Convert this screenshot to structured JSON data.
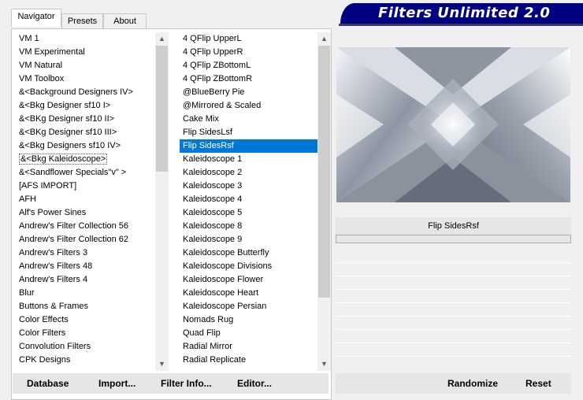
{
  "tabs": [
    "Navigator",
    "Presets",
    "About"
  ],
  "app_title": "Filters Unlimited 2.0",
  "categories": [
    "VM 1",
    "VM Experimental",
    "VM Natural",
    "VM Toolbox",
    "&<Background Designers IV>",
    "&<Bkg Designer sf10 I>",
    "&<BKg Designer sf10 II>",
    "&<BKg Designer sf10 III>",
    "&<Bkg Designers sf10 IV>",
    "&<Bkg Kaleidoscope>",
    "&<Sandflower Specials\"v\" >",
    "[AFS IMPORT]",
    "AFH",
    "Alf's Power Sines",
    "Andrew's Filter Collection 56",
    "Andrew's Filter Collection 62",
    "Andrew's Filters 3",
    "Andrew's Filters 48",
    "Andrew's Filters 4",
    "Blur",
    "Buttons & Frames",
    "Color Effects",
    "Color Filters",
    "Convolution Filters",
    "CPK Designs"
  ],
  "selected_category": "&<Bkg Kaleidoscope>",
  "filters": [
    "4 QFlip UpperL",
    "4 QFlip UpperR",
    "4 QFlip ZBottomL",
    "4 QFlip ZBottomR",
    "@BlueBerry Pie",
    "@Mirrored & Scaled",
    "Cake Mix",
    "Flip SidesLsf",
    "Flip SidesRsf",
    "Kaleidoscope 1",
    "Kaleidoscope 2",
    "Kaleidoscope 3",
    "Kaleidoscope 4",
    "Kaleidoscope 5",
    "Kaleidoscope 8",
    "Kaleidoscope 9",
    "Kaleidoscope Butterfly",
    "Kaleidoscope Divisions",
    "Kaleidoscope Flower",
    "Kaleidoscope Heart",
    "Kaleidoscope Persian",
    "Nomads Rug",
    "Quad Flip",
    "Radial Mirror",
    "Radial Replicate"
  ],
  "selected_filter": "Flip SidesRsf",
  "preview_filter_name": "Flip SidesRsf",
  "buttons": {
    "database": "Database",
    "import": "Import...",
    "filter_info": "Filter Info...",
    "editor": "Editor...",
    "randomize": "Randomize",
    "reset": "Reset"
  },
  "colors": {
    "banner": "#000080",
    "selection": "#0078d7"
  }
}
